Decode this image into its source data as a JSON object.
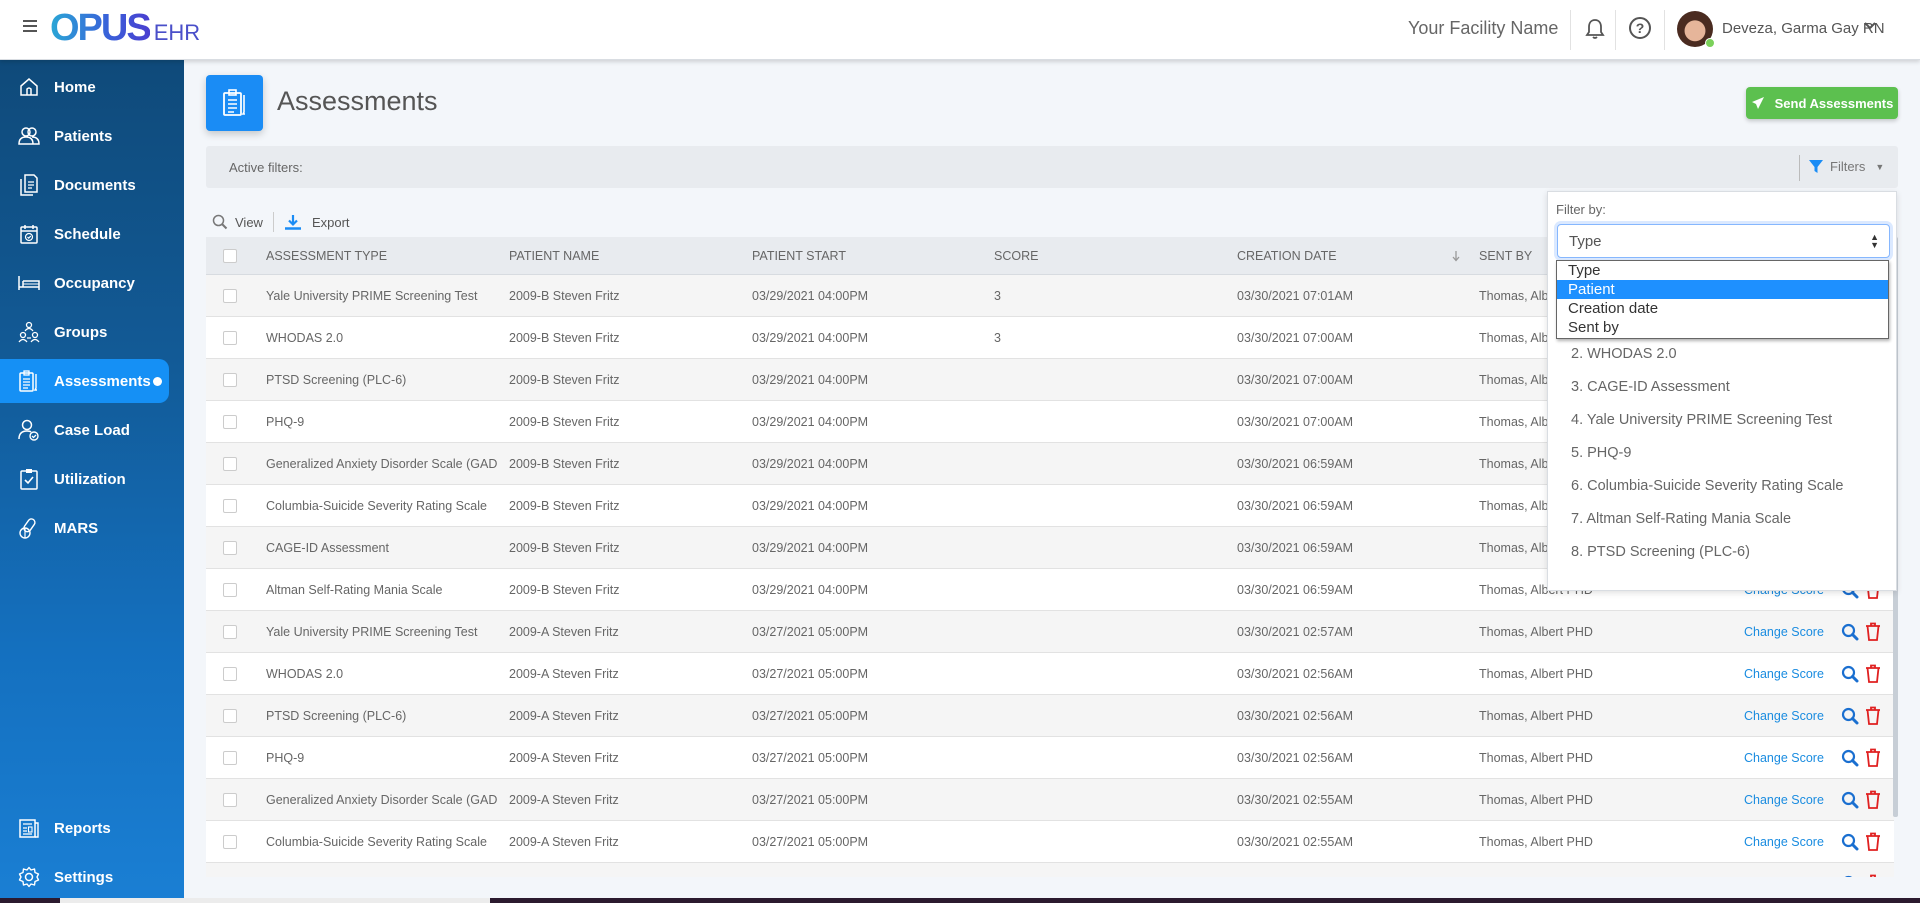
{
  "header": {
    "menu_icon": "hamburger-icon",
    "logo_main": "OPUS",
    "logo_sub": "EHR",
    "facility": "Your Facility Name",
    "notifications_icon": "bell-icon",
    "help_icon": "help-circle-icon",
    "help_glyph": "?",
    "user_name": "Deveza, Garma Gay RN",
    "user_status": "online",
    "user_chevron": "⌄"
  },
  "sidebar": {
    "items": [
      {
        "label": "Home",
        "icon": "home-icon"
      },
      {
        "label": "Patients",
        "icon": "users-icon"
      },
      {
        "label": "Documents",
        "icon": "documents-icon"
      },
      {
        "label": "Schedule",
        "icon": "calendar-icon"
      },
      {
        "label": "Occupancy",
        "icon": "bed-icon"
      },
      {
        "label": "Groups",
        "icon": "groups-icon"
      },
      {
        "label": "Assessments",
        "icon": "clipboard-icon",
        "active": true
      },
      {
        "label": "Case Load",
        "icon": "user-check-icon"
      },
      {
        "label": "Utilization",
        "icon": "clipboard-check-icon"
      },
      {
        "label": "MARS",
        "icon": "pills-icon"
      }
    ],
    "bottom_items": [
      {
        "label": "Reports",
        "icon": "reports-icon"
      },
      {
        "label": "Settings",
        "icon": "gear-icon"
      }
    ]
  },
  "page": {
    "title": "Assessments",
    "send_button": "Send Assessments",
    "active_filters_label": "Active filters:",
    "filters_button": "Filters",
    "toolbar": {
      "view": "View",
      "export": "Export"
    }
  },
  "table": {
    "columns": [
      "ASSESSMENT TYPE",
      "PATIENT NAME",
      "PATIENT START",
      "SCORE",
      "CREATION DATE",
      "SENT BY"
    ],
    "sorted_column": "CREATION DATE",
    "sort_direction": "descending",
    "action_label": "Change Score",
    "rows": [
      {
        "type": "Yale University PRIME Screening Test",
        "patient": "2009-B Steven Fritz",
        "start": "03/29/2021 04:00PM",
        "score": "3",
        "created": "03/30/2021 07:01AM",
        "sent_by": "Thomas, Albert PHD"
      },
      {
        "type": "WHODAS 2.0",
        "patient": "2009-B Steven Fritz",
        "start": "03/29/2021 04:00PM",
        "score": "3",
        "created": "03/30/2021 07:00AM",
        "sent_by": "Thomas, Albert PHD"
      },
      {
        "type": "PTSD Screening (PLC-6)",
        "patient": "2009-B Steven Fritz",
        "start": "03/29/2021 04:00PM",
        "score": "",
        "created": "03/30/2021 07:00AM",
        "sent_by": "Thomas, Albert PHD"
      },
      {
        "type": "PHQ-9",
        "patient": "2009-B Steven Fritz",
        "start": "03/29/2021 04:00PM",
        "score": "",
        "created": "03/30/2021 07:00AM",
        "sent_by": "Thomas, Albert PHD"
      },
      {
        "type": "Generalized Anxiety Disorder Scale (GAD",
        "patient": "2009-B Steven Fritz",
        "start": "03/29/2021 04:00PM",
        "score": "",
        "created": "03/30/2021 06:59AM",
        "sent_by": "Thomas, Albert PHD"
      },
      {
        "type": "Columbia-Suicide Severity Rating Scale",
        "patient": "2009-B Steven Fritz",
        "start": "03/29/2021 04:00PM",
        "score": "",
        "created": "03/30/2021 06:59AM",
        "sent_by": "Thomas, Albert PHD"
      },
      {
        "type": "CAGE-ID Assessment",
        "patient": "2009-B Steven Fritz",
        "start": "03/29/2021 04:00PM",
        "score": "",
        "created": "03/30/2021 06:59AM",
        "sent_by": "Thomas, Albert PHD"
      },
      {
        "type": "Altman Self-Rating Mania Scale",
        "patient": "2009-B Steven Fritz",
        "start": "03/29/2021 04:00PM",
        "score": "",
        "created": "03/30/2021 06:59AM",
        "sent_by": "Thomas, Albert PHD"
      },
      {
        "type": "Yale University PRIME Screening Test",
        "patient": "2009-A Steven Fritz",
        "start": "03/27/2021 05:00PM",
        "score": "",
        "created": "03/30/2021 02:57AM",
        "sent_by": "Thomas, Albert PHD"
      },
      {
        "type": "WHODAS 2.0",
        "patient": "2009-A Steven Fritz",
        "start": "03/27/2021 05:00PM",
        "score": "",
        "created": "03/30/2021 02:56AM",
        "sent_by": "Thomas, Albert PHD"
      },
      {
        "type": "PTSD Screening (PLC-6)",
        "patient": "2009-A Steven Fritz",
        "start": "03/27/2021 05:00PM",
        "score": "",
        "created": "03/30/2021 02:56AM",
        "sent_by": "Thomas, Albert PHD"
      },
      {
        "type": "PHQ-9",
        "patient": "2009-A Steven Fritz",
        "start": "03/27/2021 05:00PM",
        "score": "",
        "created": "03/30/2021 02:56AM",
        "sent_by": "Thomas, Albert PHD"
      },
      {
        "type": "Generalized Anxiety Disorder Scale (GAD",
        "patient": "2009-A Steven Fritz",
        "start": "03/27/2021 05:00PM",
        "score": "",
        "created": "03/30/2021 02:55AM",
        "sent_by": "Thomas, Albert PHD"
      },
      {
        "type": "Columbia-Suicide Severity Rating Scale",
        "patient": "2009-A Steven Fritz",
        "start": "03/27/2021 05:00PM",
        "score": "",
        "created": "03/30/2021 02:55AM",
        "sent_by": "Thomas, Albert PHD"
      },
      {
        "type": "",
        "patient": "",
        "start": "",
        "score": "",
        "created": "",
        "sent_by": ""
      }
    ]
  },
  "filter_panel": {
    "label": "Filter by:",
    "selected": "Type",
    "options": [
      "Type",
      "Patient",
      "Creation date",
      "Sent by"
    ],
    "highlighted_option": "Patient",
    "values": [
      "2. WHODAS 2.0",
      "3. CAGE-ID Assessment",
      "4. Yale University PRIME Screening Test",
      "5. PHQ-9",
      "6. Columbia-Suicide Severity Rating Scale",
      "7. Altman Self-Rating Mania Scale",
      "8. PTSD Screening (PLC-6)"
    ]
  },
  "colors": {
    "brand_blue": "#1a8cf5",
    "sidebar_top": "#0f4a7a",
    "sidebar_bottom": "#1a7fd4",
    "send_green": "#5cc04f",
    "link_blue": "#1a8ce0",
    "delete_red": "#e02020"
  }
}
